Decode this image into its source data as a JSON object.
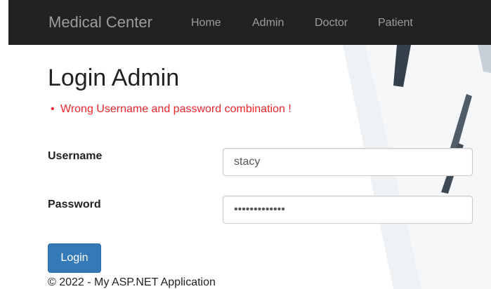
{
  "navbar": {
    "brand": "Medical Center",
    "items": [
      {
        "label": "Home"
      },
      {
        "label": "Admin"
      },
      {
        "label": "Doctor"
      },
      {
        "label": "Patient"
      }
    ]
  },
  "page": {
    "title": "Login Admin",
    "errors": [
      "Wrong Username and password combination !"
    ]
  },
  "form": {
    "username_label": "Username",
    "username_value": "stacy",
    "password_label": "Password",
    "password_value": "•••••••••••••",
    "submit_label": "Login"
  },
  "footer": {
    "text": "© 2022 - My ASP.NET Application"
  },
  "colors": {
    "navbar_bg": "#222222",
    "nav_text": "#9d9d9d",
    "error": "#e8262d",
    "primary": "#337ab7"
  }
}
